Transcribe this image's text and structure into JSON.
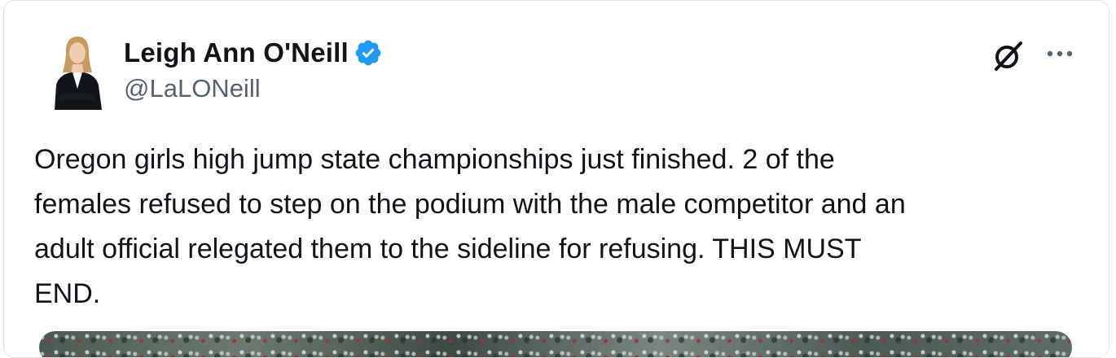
{
  "author": {
    "name": "Leigh Ann O'Neill",
    "handle": "@LaLONeill",
    "verified": true
  },
  "tweet": {
    "text": "Oregon girls high jump state championships just finished. 2 of the\nfemales refused to step on the podium with the male competitor and an\nadult official relegated them to the sideline for refusing. THIS MUST\nEND."
  },
  "icons": {
    "verified": "verified-badge-icon",
    "grok": "grok-icon",
    "more": "more-horizontal-icon"
  },
  "colors": {
    "name_text": "#0f1419",
    "handle_text": "#536471",
    "verified_blue": "#1d9bf0",
    "card_border": "#dfe3e7"
  }
}
